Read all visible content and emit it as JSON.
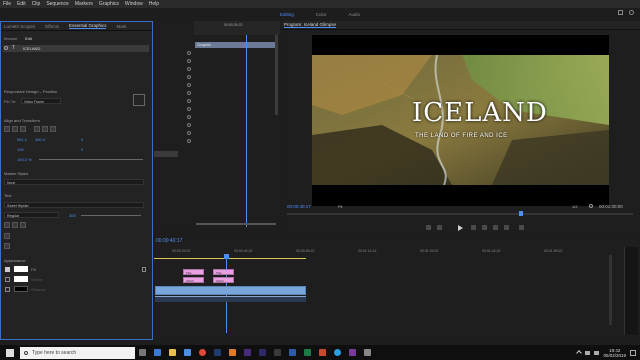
{
  "menubar": {
    "items": [
      "File",
      "Edit",
      "Clip",
      "Sequence",
      "Markers",
      "Graphics",
      "Window",
      "Help"
    ]
  },
  "workspaces": {
    "items": [
      "Editing",
      "Color",
      "Audio"
    ],
    "active": "Editing"
  },
  "eg_panel": {
    "tabs": [
      "Lumetri Scopes",
      "Effects",
      "Essential Graphics",
      "Mark"
    ],
    "active_tab": "Essential Graphics",
    "subtabs": [
      "Browse",
      "Edit"
    ],
    "layer_name": "ICELAND",
    "sections": {
      "responsive": "Responsive Design – Position",
      "pin_to": "Pin To:",
      "pin_value": "Video Frame",
      "align": "Align and Transform",
      "master_styles": "Master Styles",
      "master_value": "None",
      "text": "Text",
      "font": "Sweet Hipster",
      "font_style": "Regular",
      "font_size": "300",
      "appearance": "Appearance",
      "fill": "Fill",
      "stroke": "Stroke",
      "shadow": "Shadow"
    },
    "transform_values": {
      "x": "961.1",
      "y": "450.4",
      "scale": "100",
      "rotation": "0",
      "opacity": "100.0 %"
    }
  },
  "effect_controls": {
    "timecode": "00:00:39:22",
    "clip_label": "Graphic"
  },
  "program_monitor": {
    "title": "Program: Iceland Glimpse",
    "overlay_title": "ICELAND",
    "overlay_subtitle": "THE LAND OF FIRE AND ICE",
    "timecode_current": "00:00:40:17",
    "fit": "Fit",
    "quality": "1/2",
    "timecode_duration": "00:01:00:00"
  },
  "timeline": {
    "timecode": "00:00:40:17",
    "ruler_labels": [
      "00:00:29:22",
      "00:00:44:22",
      "00:00:59:22",
      "00:01:14:22",
      "00:01:29:22",
      "00:01:44:22",
      "00:01:59:22"
    ],
    "clips_v": [
      "Title",
      "Title"
    ],
    "clips_pink": [
      "Glitch",
      "Glitch"
    ]
  },
  "taskbar": {
    "search_placeholder": "Type here to search",
    "time": "19:42",
    "date": "05/02/2019"
  },
  "colors": {
    "accent": "#4f8df5",
    "clip_pink": "#e8a0e0",
    "clip_blue": "#7aa5d8",
    "panel": "#232323"
  }
}
